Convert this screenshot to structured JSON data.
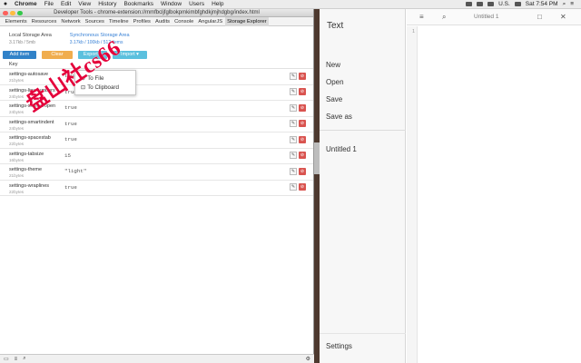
{
  "menubar": {
    "app": "Chrome",
    "items": [
      "File",
      "Edit",
      "View",
      "History",
      "Bookmarks",
      "Window",
      "Users",
      "Help"
    ],
    "locale": "U.S.",
    "clock": "Sat 7:54 PM"
  },
  "devtools": {
    "title": "Developer Tools - chrome-extension://mmfbcljfglbokpmkimbfghdkjmjhdgbg/index.html",
    "tabs": [
      "Elements",
      "Resources",
      "Network",
      "Sources",
      "Timeline",
      "Profiles",
      "Audits",
      "Console",
      "AngularJS",
      "Storage Explorer"
    ],
    "local_area": {
      "name": "Local Storage Area",
      "size": "3.17kb / 5mb"
    },
    "sync_area": {
      "name": "Synchronous Storage Area",
      "size": "3.17kb / 100kb / 512 items"
    },
    "buttons": {
      "add": "Add item",
      "clear": "Clear",
      "export": "Export",
      "import": "Import"
    },
    "export_menu": [
      "To File",
      "To Clipboard"
    ],
    "col_key": "Key",
    "rows": [
      {
        "key": "settings-autosave",
        "size": "21bytes",
        "value": "true"
      },
      {
        "key": "settings-linenumbers",
        "size": "24bytes",
        "value": "true"
      },
      {
        "key": "settings-sidebaropen",
        "size": "24bytes",
        "value": "true"
      },
      {
        "key": "settings-smartindent",
        "size": "24bytes",
        "value": "true"
      },
      {
        "key": "settings-spacestab",
        "size": "22bytes",
        "value": "true"
      },
      {
        "key": "settings-tabsize",
        "size": "16bytes",
        "value": "15"
      },
      {
        "key": "settings-theme",
        "size": "21bytes",
        "value": "\"light\""
      },
      {
        "key": "settings-wraplines",
        "size": "22bytes",
        "value": "true"
      }
    ]
  },
  "watermark": "盘山社cs66",
  "text_app": {
    "title": "Text",
    "menu": {
      "new": "New",
      "open": "Open",
      "save": "Save",
      "save_as": "Save as"
    },
    "file": "Untitled 1",
    "settings": "Settings",
    "doc_title": "Untitled 1",
    "line_number": "1"
  },
  "colors": {
    "add": "#3182c8",
    "clear": "#f0ad4e",
    "export": "#5bc0de",
    "delete": "#d9534f",
    "watermark": "#e4003a"
  }
}
